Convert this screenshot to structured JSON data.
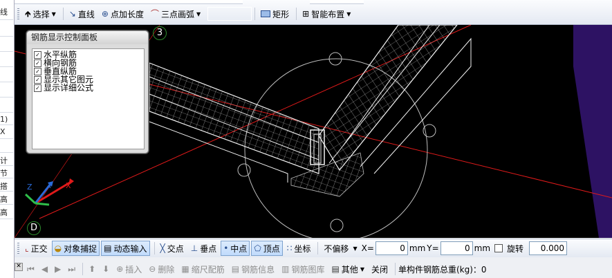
{
  "left_panel": {
    "items": [
      "线",
      "",
      "",
      "",
      "",
      "",
      "",
      "",
      "1)",
      "X",
      "",
      "计",
      "节",
      "搭",
      "高",
      "高"
    ]
  },
  "top_toolbar": {
    "select": {
      "label": "选择",
      "icon": "cursor-arrow-icon"
    },
    "line": {
      "label": "直线",
      "icon": "line-tool-icon"
    },
    "point_length": {
      "label": "点加长度",
      "icon": "point-length-icon"
    },
    "arc": {
      "label": "三点画弧",
      "icon": "arc-tool-icon"
    },
    "rect": {
      "label": "矩形",
      "icon": "rectangle-icon"
    },
    "smart_layout": {
      "label": "智能布置",
      "icon": "smart-layout-icon"
    }
  },
  "rebar_panel": {
    "title": "钢筋显示控制面板",
    "options": [
      {
        "label": "水平纵筋",
        "checked": true
      },
      {
        "label": "横向钢筋",
        "checked": true
      },
      {
        "label": "垂直纵筋",
        "checked": true
      },
      {
        "label": "显示其它图元",
        "checked": true
      },
      {
        "label": "显示详细公式",
        "checked": true
      }
    ]
  },
  "axis_labels": {
    "top": "3",
    "bottom": "D"
  },
  "view_colors": {
    "axis_line": "#e01a1a",
    "wire": "#f4f4f4",
    "wall": "#2d1263",
    "grid_bubble": "#2d8b2d"
  },
  "snap_toolbar": {
    "ortho": "正交",
    "object_snap": "对象捕捉",
    "dynamic_input": "动态输入",
    "intersection": "交点",
    "perpendicular": "垂点",
    "midpoint": "中点",
    "vertex": "顶点",
    "coordinate": "坐标",
    "offset_mode": "不偏移",
    "x_label": "X=",
    "x_value": "0",
    "y_label": "Y=",
    "y_value": "0",
    "unit": "mm",
    "rotate_label": "旋转",
    "rotate_value": "0.000"
  },
  "status_bar": {
    "insert": "插入",
    "delete": "删除",
    "scale": "缩尺配筋",
    "rebar_info": "钢筋信息",
    "rebar_lib": "钢筋图库",
    "other": "其他",
    "close": "关闭",
    "total": "单构件钢筋总重(kg)：0"
  }
}
